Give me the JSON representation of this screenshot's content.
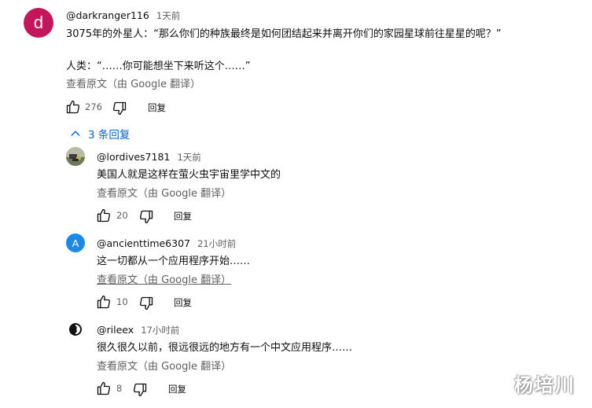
{
  "comment": {
    "avatar_letter": "d",
    "avatar_color": "#c2185b",
    "handle": "@darkranger116",
    "time": "1天前",
    "line1": "3075年的外星人：“那么你们的种族最终是如何团结起来并离开你们的家园星球前往星星的呢？”",
    "line2": "人类：“……你可能想坐下来听这个……”",
    "translate": "查看原文（由 Google 翻译）",
    "likes": "276",
    "reply_label": "回复"
  },
  "replies_toggle": {
    "icon": "chevron-up-icon",
    "label": "3 条回复",
    "color": "#065fd4"
  },
  "replies": [
    {
      "handle": "@lordives7181",
      "time": "1天前",
      "text": "美国人就是这样在萤火虫宇宙里学中文的",
      "translate": "查看原文（由 Google 翻译）",
      "likes": "20",
      "reply_label": "回复"
    },
    {
      "avatar_letter": "A",
      "avatar_color": "#1e88e5",
      "handle": "@ancienttime6307",
      "time": "21小时前",
      "text": "这一切都从一个应用程序开始……",
      "translate": "查看原文（由 Google 翻译）",
      "likes": "10",
      "reply_label": "回复"
    },
    {
      "handle": "@rileex",
      "time": "17小时前",
      "text": "很久很久以前，很远很远的地方有一个中文应用程序……",
      "translate": "查看原文（由 Google 翻译）",
      "likes": "8",
      "reply_label": "回复"
    }
  ],
  "watermark": "杨培川"
}
